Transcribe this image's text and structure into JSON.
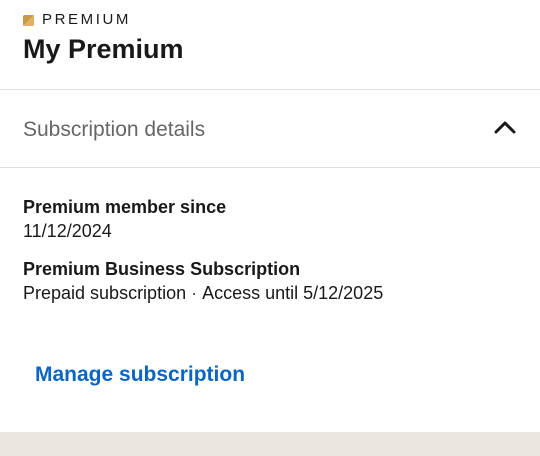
{
  "header": {
    "brand_label": "PREMIUM",
    "title": "My Premium"
  },
  "subscription_section": {
    "title": "Subscription details",
    "expanded": true,
    "member_since_label": "Premium member since",
    "member_since_value": "11/12/2024",
    "plan_name": "Premium Business Subscription",
    "plan_type": "Prepaid subscription",
    "separator": "·",
    "access_until": "Access until 5/12/2025",
    "manage_label": "Manage subscription"
  },
  "colors": {
    "premium_gold": "#c89a4a",
    "link_blue": "#0a66c2",
    "muted_text": "#666666",
    "footer_band": "#e9e6e0"
  },
  "icons": {
    "brand": "premium-square-icon",
    "collapse": "chevron-up-icon"
  }
}
